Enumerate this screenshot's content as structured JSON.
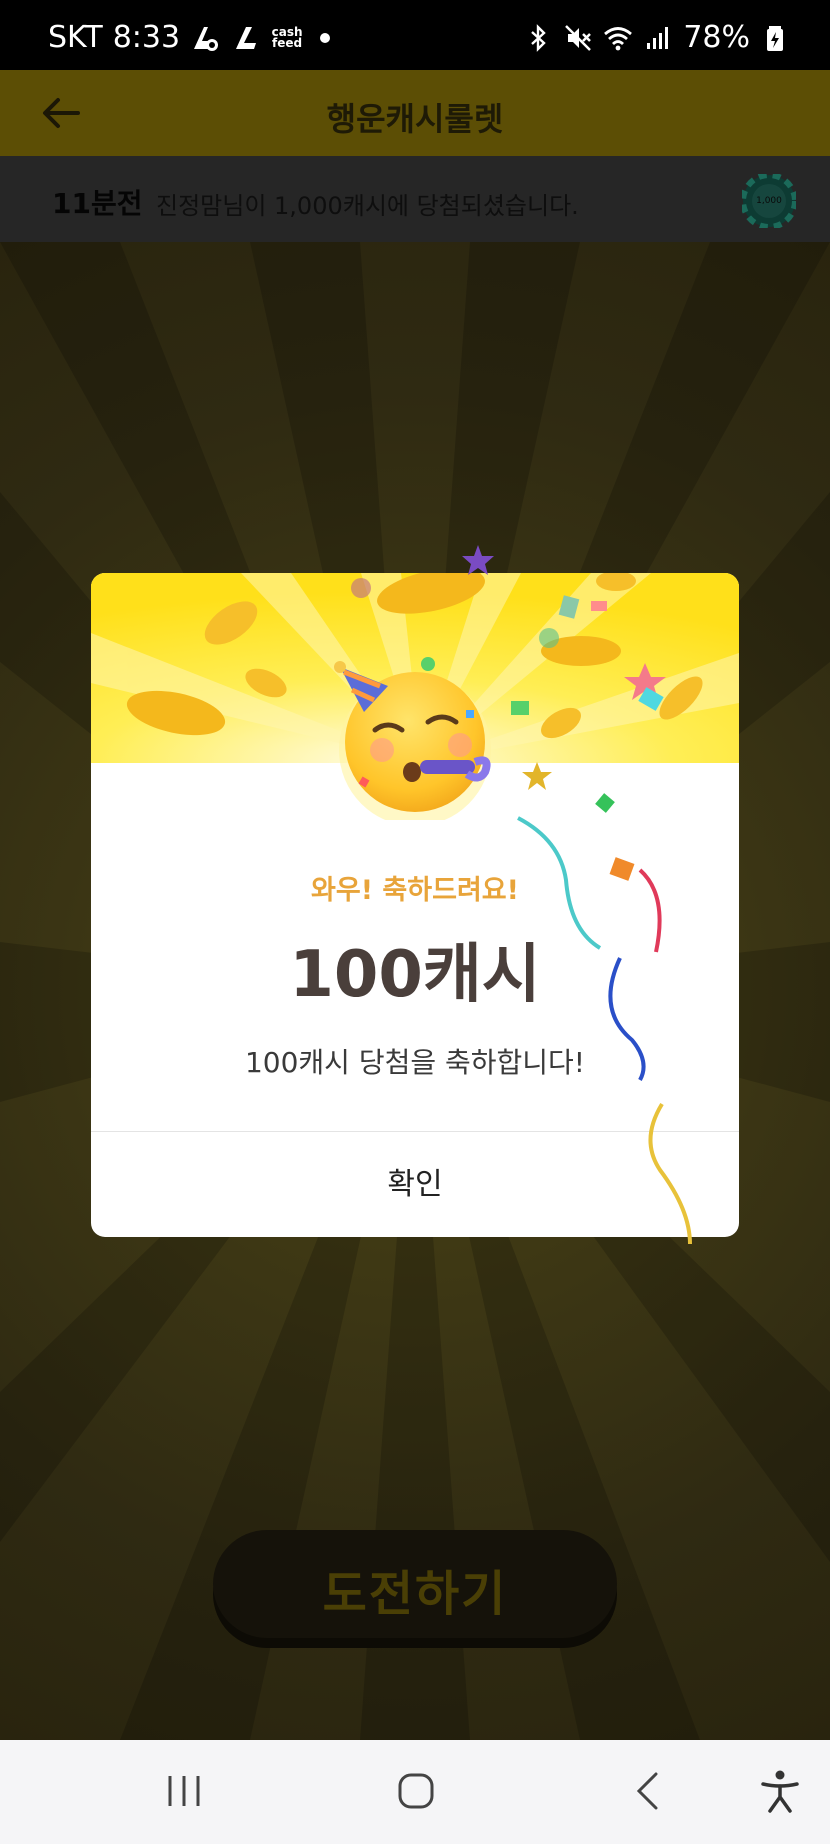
{
  "status_bar": {
    "carrier": "SKT",
    "time": "8:33",
    "cashfeed_text": "cash feed",
    "battery": "78%"
  },
  "header": {
    "title": "행운캐시룰렛"
  },
  "ticker": {
    "time": "11분전",
    "message": "진정맘님이 1,000캐시에 당첨되셨습니다.",
    "chip_label": "1,000"
  },
  "main": {
    "challenge_label": "도전하기"
  },
  "modal": {
    "wow": "와우! 축하드려요!",
    "amount": "100캐시",
    "description": "100캐시 당첨을 축하합니다!",
    "confirm_label": "확인"
  },
  "colors": {
    "banner": "#ffe01a",
    "accent": "#e8a43a",
    "amount": "#4a3f3b"
  },
  "icons": [
    "back-arrow-icon",
    "casino-chip-icon",
    "party-face-icon",
    "bluetooth-icon",
    "mute-icon",
    "wifi-icon",
    "signal-icon",
    "battery-icon",
    "recent-apps-icon",
    "home-icon",
    "back-icon",
    "accessibility-icon"
  ]
}
